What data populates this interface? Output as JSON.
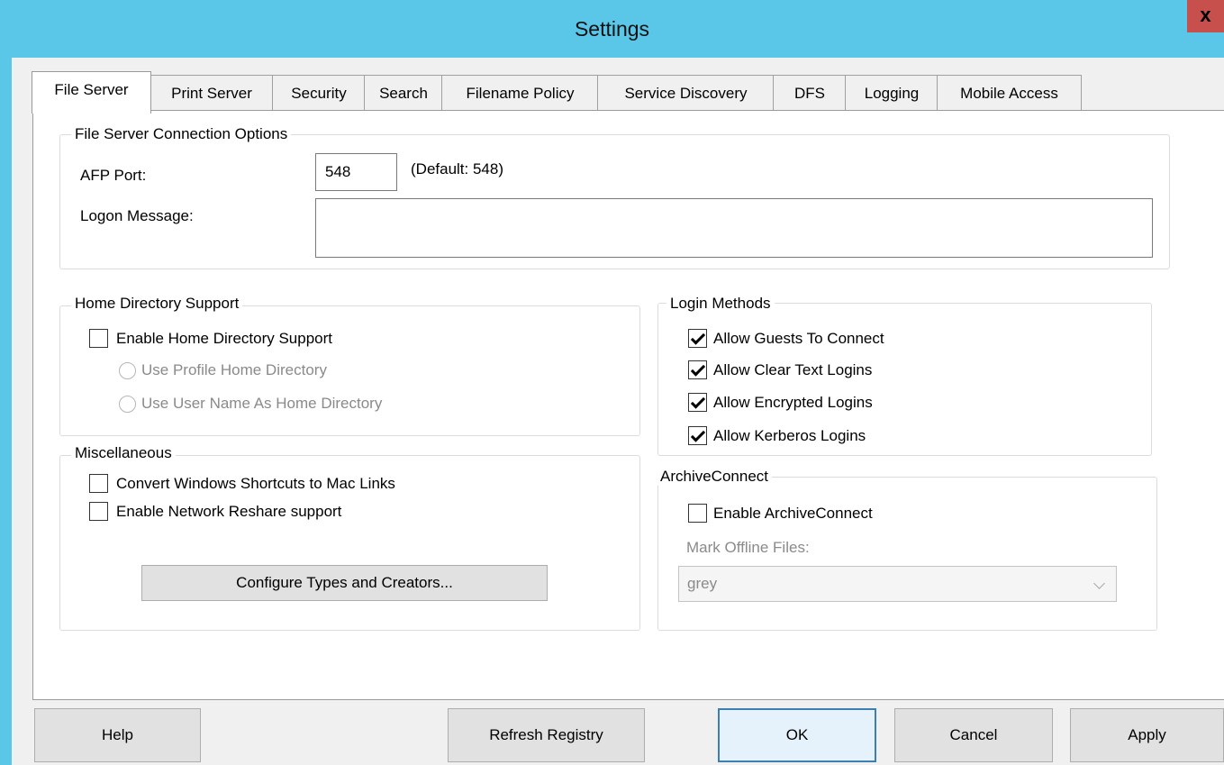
{
  "window": {
    "title": "Settings",
    "close_glyph": "x"
  },
  "tabs": [
    {
      "label": "File Server",
      "active": true
    },
    {
      "label": "Print Server"
    },
    {
      "label": "Security"
    },
    {
      "label": "Search"
    },
    {
      "label": "Filename Policy"
    },
    {
      "label": "Service Discovery"
    },
    {
      "label": "DFS"
    },
    {
      "label": "Logging"
    },
    {
      "label": "Mobile Access"
    }
  ],
  "connection": {
    "legend": "File Server Connection Options",
    "afp_port_label": "AFP Port:",
    "afp_port_value": "548",
    "afp_port_default": "(Default: 548)",
    "logon_message_label": "Logon Message:",
    "logon_message_value": ""
  },
  "home_directory": {
    "legend": "Home Directory Support",
    "enable_label": "Enable Home Directory Support",
    "enable_checked": false,
    "profile_label": "Use Profile Home Directory",
    "username_label": "Use User Name As Home Directory"
  },
  "misc": {
    "legend": "Miscellaneous",
    "convert_label": "Convert Windows Shortcuts to Mac Links",
    "convert_checked": false,
    "reshare_label": "Enable Network Reshare support",
    "reshare_checked": false,
    "configure_button": "Configure Types and Creators..."
  },
  "login_methods": {
    "legend": "Login Methods",
    "items": [
      {
        "label": "Allow Guests To Connect",
        "checked": true
      },
      {
        "label": "Allow Clear Text Logins",
        "checked": true
      },
      {
        "label": "Allow Encrypted Logins",
        "checked": true
      },
      {
        "label": "Allow Kerberos Logins",
        "checked": true
      }
    ]
  },
  "archive": {
    "legend": "ArchiveConnect",
    "enable_label": "Enable ArchiveConnect",
    "enable_checked": false,
    "mark_label": "Mark Offline Files:",
    "mark_value": "grey"
  },
  "footer": {
    "help": "Help",
    "refresh": "Refresh Registry",
    "ok": "OK",
    "cancel": "Cancel",
    "apply": "Apply"
  },
  "colors": {
    "titlebar": "#5ac6e8",
    "close": "#c7504c",
    "default_button_border": "#3c7fb1"
  }
}
